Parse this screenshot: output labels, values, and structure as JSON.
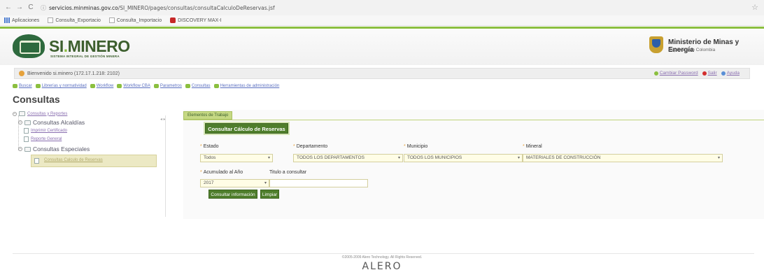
{
  "browser": {
    "back": "←",
    "forward": "→",
    "reload": "C",
    "info": "ⓘ",
    "url_host": "servicios.minminas.gov.co",
    "url_path": "/SI_MINERO/pages/consultas/consultaCalculoDeReservas.jsf",
    "star": "☆",
    "bookmarks": [
      {
        "label": "Aplicaciones",
        "icon": "apps-icon"
      },
      {
        "label": "Consulta_Exportacio",
        "icon": "page-icon"
      },
      {
        "label": "Consulta_Importacio",
        "icon": "page-icon"
      },
      {
        "label": "DISCOVERY MAX-I",
        "icon": "video-icon"
      }
    ]
  },
  "header": {
    "logo_name_main": "SI",
    "logo_name_dot": ".",
    "logo_name_rest": "MINERO",
    "logo_subtitle": "SISTEMA INTEGRAL DE GESTIÓN MINERA",
    "ministry": "Ministerio de Minas y Energía",
    "republic": "República de Colombia"
  },
  "welcome": {
    "text": "Bienvenido si.minero (172.17.1.218: 2102)",
    "links": [
      "Cambiar Password",
      "Salir",
      "Ayuda"
    ]
  },
  "menu": {
    "items": [
      "Buscar",
      "Librerías y normatividad",
      "Workflow",
      "Workflow CBA",
      "Parametros",
      "Consultas",
      "Herramientas de administración"
    ]
  },
  "page_title": "Consultas",
  "tree": {
    "root": "Consultas y Reportes",
    "alcaldias": "Consultas Alcaldías",
    "imprimir": "Imprimir Certificado",
    "reporte": "Reporte General",
    "especiales": "Consultas Especiales",
    "calculo": "Consultas Calculo de Reservas"
  },
  "splitter": "◂ ▸",
  "tab_label": "Elementos de Trabajo",
  "section_title": "Consultar Cálculo de Reservas",
  "form": {
    "estado": {
      "label": "Estado",
      "value": "Todos"
    },
    "departamento": {
      "label": "Departamento",
      "value": "TODOS LOS DEPARTAMENTOS"
    },
    "municipio": {
      "label": "Municipio",
      "value": "TODOS LOS MUNICIPIOS"
    },
    "mineral": {
      "label": "Mineral",
      "value": "MATERIALES DE CONSTRUCCIÓN"
    },
    "anio": {
      "label": "Acumulado al Año",
      "value": "2017"
    },
    "titulo": {
      "label": "Titulo a consultar",
      "value": ""
    },
    "consultar_btn": "Consultar información",
    "limpiar_btn": "Limpiar",
    "required_mark": "*",
    "arrow": "▾"
  },
  "footer": {
    "copyright": "©2005-2009 Alero Technology. All Rights Reserved.",
    "brand": "ALERO"
  }
}
